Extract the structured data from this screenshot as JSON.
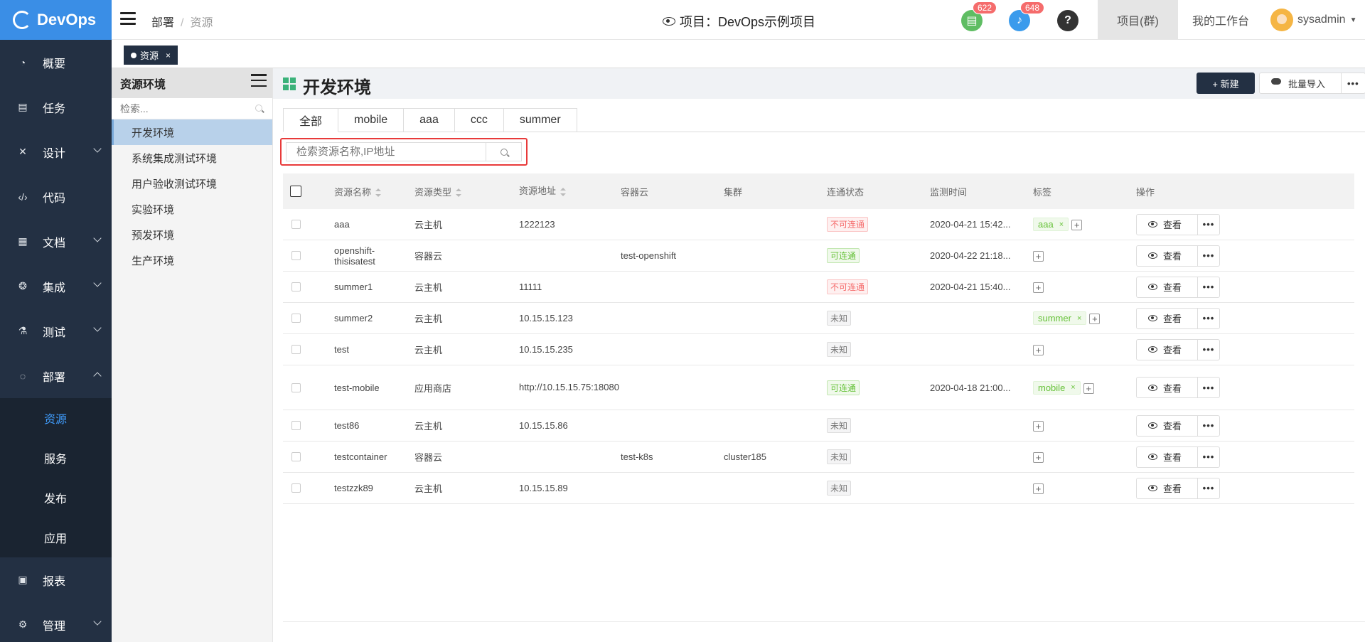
{
  "app": {
    "name": "DevOps"
  },
  "sidebar": {
    "items": [
      {
        "label": "概要"
      },
      {
        "label": "任务"
      },
      {
        "label": "设计"
      },
      {
        "label": "代码"
      },
      {
        "label": "文档"
      },
      {
        "label": "集成"
      },
      {
        "label": "测试"
      },
      {
        "label": "部署"
      },
      {
        "label": "报表"
      },
      {
        "label": "管理"
      }
    ],
    "deploy_children": [
      {
        "label": "资源"
      },
      {
        "label": "服务"
      },
      {
        "label": "发布"
      },
      {
        "label": "应用"
      }
    ]
  },
  "header": {
    "breadcrumb": [
      "部署",
      "资源"
    ],
    "project": "项目：DevOps示例项目",
    "doc_badge": "622",
    "bell_badge": "648",
    "help": "?",
    "nav_project_group": "项目(群)",
    "nav_workspace": "我的工作台",
    "username": "sysadmin"
  },
  "opened_tab": {
    "label": "资源",
    "close": "×"
  },
  "env_panel": {
    "title": "资源环境",
    "search_placeholder": "检索...",
    "items": [
      "开发环境",
      "系统集成测试环境",
      "用户验收测试环境",
      "实验环境",
      "预发环境",
      "生产环境"
    ]
  },
  "main": {
    "title": "开发环境",
    "new_button": "+ 新建",
    "import_button": "批量导入",
    "more": "•••",
    "tabs": [
      "全部",
      "mobile",
      "aaa",
      "ccc",
      "summer"
    ],
    "search_placeholder": "检索资源名称,IP地址",
    "columns": [
      "资源名称",
      "资源类型",
      "资源地址",
      "容器云",
      "集群",
      "连通状态",
      "监测时间",
      "标签",
      "操作"
    ],
    "view_label": "查看",
    "rows": [
      {
        "name": "aaa",
        "type": "云主机",
        "addr": "1222123",
        "cloud": "",
        "cluster": "",
        "status": "不可连通",
        "status_kind": "bad",
        "time": "2020-04-21 15:42...",
        "tags": [
          "aaa"
        ]
      },
      {
        "name": "openshift-thisisatest",
        "type": "容器云",
        "addr": "",
        "cloud": "test-openshift",
        "cluster": "",
        "status": "可连通",
        "status_kind": "ok",
        "time": "2020-04-22 21:18...",
        "tags": []
      },
      {
        "name": "summer1",
        "type": "云主机",
        "addr": "11111",
        "cloud": "",
        "cluster": "",
        "status": "不可连通",
        "status_kind": "bad",
        "time": "2020-04-21 15:40...",
        "tags": []
      },
      {
        "name": "summer2",
        "type": "云主机",
        "addr": "10.15.15.123",
        "cloud": "",
        "cluster": "",
        "status": "未知",
        "status_kind": "unk",
        "time": "",
        "tags": [
          "summer"
        ]
      },
      {
        "name": "test",
        "type": "云主机",
        "addr": "10.15.15.235",
        "cloud": "",
        "cluster": "",
        "status": "未知",
        "status_kind": "unk",
        "time": "",
        "tags": []
      },
      {
        "name": "test-mobile",
        "type": "应用商店",
        "addr": "http://10.15.15.75:18080",
        "cloud": "",
        "cluster": "",
        "status": "可连通",
        "status_kind": "ok",
        "time": "2020-04-18 21:00...",
        "tags": [
          "mobile"
        ]
      },
      {
        "name": "test86",
        "type": "云主机",
        "addr": "10.15.15.86",
        "cloud": "",
        "cluster": "",
        "status": "未知",
        "status_kind": "unk",
        "time": "",
        "tags": []
      },
      {
        "name": "testcontainer",
        "type": "容器云",
        "addr": "",
        "cloud": "test-k8s",
        "cluster": "cluster185",
        "status": "未知",
        "status_kind": "unk",
        "time": "",
        "tags": []
      },
      {
        "name": "testzzk89",
        "type": "云主机",
        "addr": "10.15.15.89",
        "cloud": "",
        "cluster": "",
        "status": "未知",
        "status_kind": "unk",
        "time": "",
        "tags": []
      }
    ]
  },
  "colors": {
    "brand": "#3a8ee6",
    "sidebar": "#233043",
    "active": "#409eff",
    "highlight": "#e83a3a"
  }
}
